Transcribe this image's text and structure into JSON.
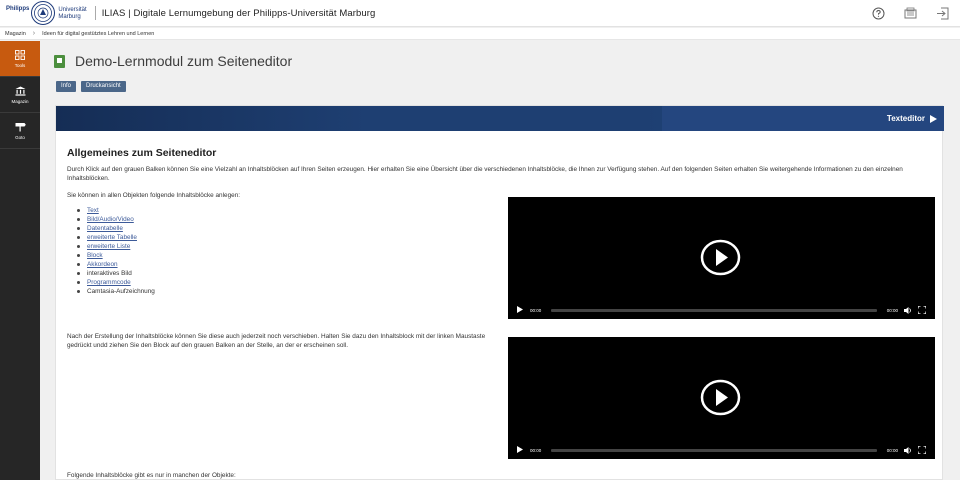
{
  "header": {
    "logo_left_1": "Philipps",
    "logo_right_1": "Universität",
    "logo_right_2": "Marburg",
    "app_title": "ILIAS | Digitale Lernumgebung der Philipps-Universität Marburg",
    "icons": [
      "help-icon",
      "badge-icon",
      "logout-icon"
    ]
  },
  "breadcrumb": {
    "items": [
      "Magazin",
      "Ideen für digital gestütztes Lehren und Lernen"
    ]
  },
  "sidebar": {
    "items": [
      {
        "label": "Tools",
        "icon": "tools-grid-icon",
        "active": true
      },
      {
        "label": "Magazin",
        "icon": "repository-icon",
        "active": false
      },
      {
        "label": "Goto",
        "icon": "goto-icon",
        "active": false
      }
    ]
  },
  "main": {
    "page_title": "Demo-Lernmodul zum Seiteneditor",
    "buttons": [
      "Info",
      "Druckansicht"
    ],
    "editor_label": "Texteditor",
    "section_title": "Allgemeines zum Seiteneditor",
    "intro": "Durch Klick auf den grauen Balken können Sie eine Vielzahl an Inhaltsblöcken auf Ihren Seiten erzeugen. Hier erhalten Sie eine Übersicht über die verschiedenen Inhaltsblöcke, die Ihnen zur Verfügung stehen. Auf den folgenden Seiten erhalten Sie weitergehende Informationen zu den einzelnen Inhaltsblöcken.",
    "list_intro": "Sie können in allen Objekten folgende Inhaltsblöcke anlegen:",
    "blocks": [
      {
        "label": "Text",
        "link": true
      },
      {
        "label": "Bild/Audio/Video",
        "link": true
      },
      {
        "label": "Datentabelle",
        "link": true
      },
      {
        "label": "erweiterte Tabelle",
        "link": true
      },
      {
        "label": "erweiterte Liste",
        "link": true
      },
      {
        "label": "Block",
        "link": true
      },
      {
        "label": "Akkordeon",
        "link": true
      },
      {
        "label": "interaktives Bild",
        "link": false
      },
      {
        "label": "Programmcode",
        "link": true
      },
      {
        "label": "Camtasia-Aufzeichnung",
        "link": false
      }
    ],
    "para2": "Nach der Erstellung der Inhaltsblöcke können Sie diese auch jederzeit noch verschieben. Halten Sie dazu den Inhaltsblock mit der linken Maustaste gedrückt undd ziehen Sie den Block auf den grauen Balken an der Stelle, an der er erscheinen soll.",
    "para3": "Folgende Inhaltsblöcke gibt es nur in manchen der Objekte:",
    "videos": [
      {
        "current_time": "00:00",
        "duration": "00:00"
      },
      {
        "current_time": "00:00",
        "duration": "00:00"
      }
    ]
  }
}
